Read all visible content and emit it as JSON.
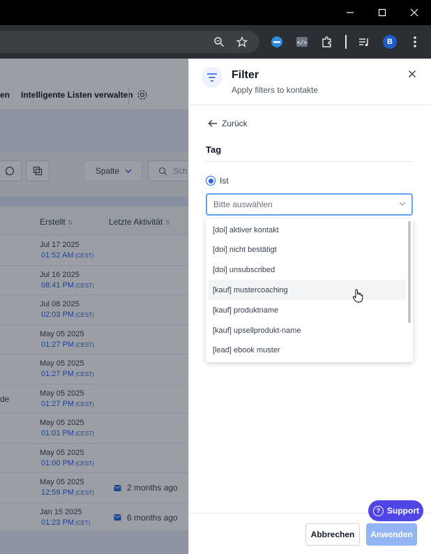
{
  "browser": {
    "profile_initial": "B",
    "icons": [
      "zoom-icon",
      "star-icon",
      "extension-blue-icon",
      "code-icon",
      "puzzle-icon",
      "media-icon",
      "avatar",
      "menu-icon"
    ]
  },
  "app": {
    "nav": {
      "partial_item": "en",
      "manage_lists": "Intelligente Listen verwalten"
    },
    "filterbar": {
      "column_button": "Spalte",
      "search_placeholder": "Sch"
    },
    "table": {
      "headers": {
        "created": "Erstellt",
        "last_activity": "Letzte Aktivität"
      },
      "rows": [
        {
          "date": "Jul 17 2025",
          "time": "01:52 AM",
          "tz": "(CEST)",
          "activity": "",
          "left": ""
        },
        {
          "date": "Jul 16 2025",
          "time": "08:41 PM",
          "tz": "(CEST)",
          "activity": "",
          "left": ""
        },
        {
          "date": "Jul 08 2025",
          "time": "02:03 PM",
          "tz": "(CEST)",
          "activity": "",
          "left": ""
        },
        {
          "date": "May 05 2025",
          "time": "01:27 PM",
          "tz": "(CEST)",
          "activity": "",
          "left": ""
        },
        {
          "date": "May 05 2025",
          "time": "01:27 PM",
          "tz": "(CEST)",
          "activity": "",
          "left": ""
        },
        {
          "date": "May 05 2025",
          "time": "01:27 PM",
          "tz": "(CEST)",
          "activity": "",
          "left": "de"
        },
        {
          "date": "May 05 2025",
          "time": "01:01 PM",
          "tz": "(CEST)",
          "activity": "",
          "left": ""
        },
        {
          "date": "May 05 2025",
          "time": "01:00 PM",
          "tz": "(CEST)",
          "activity": "",
          "left": ""
        },
        {
          "date": "May 05 2025",
          "time": "12:59 PM",
          "tz": "(CEST)",
          "activity": "2 months ago",
          "left": ""
        },
        {
          "date": "Jan 15 2025",
          "time": "01:23 PM",
          "tz": "(CET)",
          "activity": "6 months ago",
          "left": ""
        }
      ]
    }
  },
  "drawer": {
    "title": "Filter",
    "subtitle": "Apply filters to kontakte",
    "back": "Zurück",
    "section": "Tag",
    "radio_label": "Ist",
    "select_placeholder": "Bitte auswählen",
    "options": [
      "[doi] aktiver kontakt",
      "[doi] nicht bestätigt",
      "[doi] unsubscribed",
      "[kauf] mustercoaching",
      "[kauf] produktname",
      "[kauf] upsellprodukt-name",
      "[lead] ebook muster"
    ],
    "hovered_option": "[kauf] mustercoaching",
    "cancel": "Abbrechen",
    "apply": "Anwenden"
  },
  "support": {
    "label": "Support"
  },
  "colors": {
    "accent": "#2563eb",
    "support": "#4f46e5",
    "apply_disabled": "#93b4f5"
  }
}
